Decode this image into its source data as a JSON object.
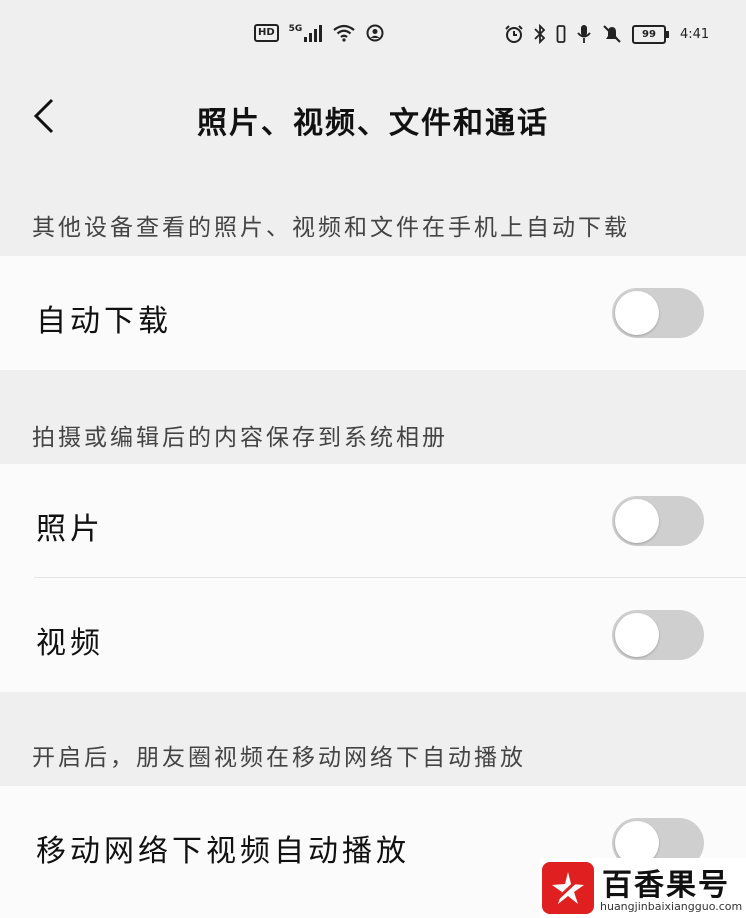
{
  "status_bar": {
    "left_badge": "HD",
    "network": "5G",
    "battery_level": "99",
    "time": "4:41"
  },
  "header": {
    "title": "照片、视频、文件和通话"
  },
  "sections": [
    {
      "label": "其他设备查看的照片、视频和文件在手机上自动下载",
      "rows": [
        {
          "label": "自动下载",
          "enabled": false
        }
      ]
    },
    {
      "label": "拍摄或编辑后的内容保存到系统相册",
      "rows": [
        {
          "label": "照片",
          "enabled": false
        },
        {
          "label": "视频",
          "enabled": false
        }
      ]
    },
    {
      "label": "开启后，朋友圈视频在移动网络下自动播放",
      "rows": [
        {
          "label": "移动网络下视频自动播放",
          "enabled": false
        }
      ]
    }
  ],
  "watermark": {
    "brand": "百香果号",
    "url": "huangjinbaixiangguo.com"
  },
  "colors": {
    "background": "#efefef",
    "card": "#fbfbfb",
    "toggle_off": "#cfcfcf",
    "watermark_logo": "#e02020"
  }
}
